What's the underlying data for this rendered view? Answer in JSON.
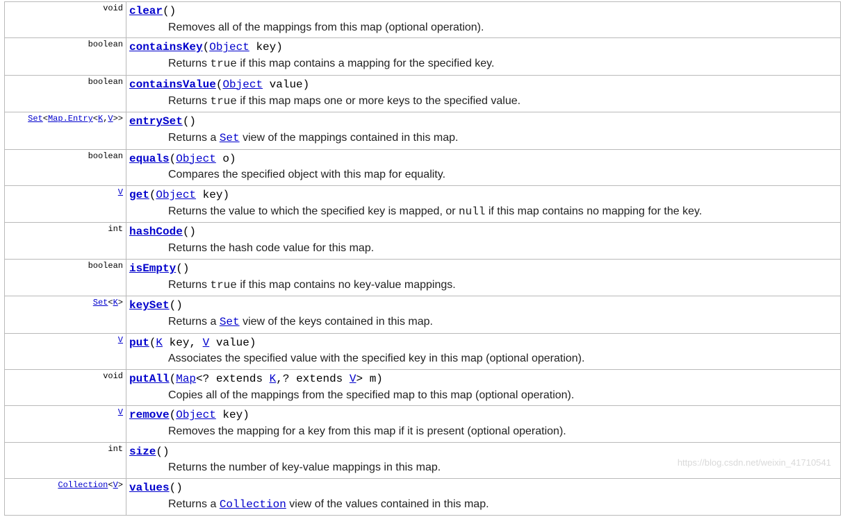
{
  "watermark": "https://blog.csdn.net/weixin_41710541",
  "methods": [
    {
      "ret_pre": "void",
      "sig_html": "<span class='mname'>clear</span>()",
      "desc_html": "Removes all of the mappings from this map (optional operation)."
    },
    {
      "ret_pre": "boolean",
      "sig_html": "<span class='mname'>containsKey</span>(<span class='plink'>Object</span> key)",
      "desc_html": "Returns <span class='code'>true</span> if this map contains a mapping for the specified key."
    },
    {
      "ret_pre": "boolean",
      "sig_html": "<span class='mname'>containsValue</span>(<span class='plink'>Object</span> value)",
      "desc_html": "Returns <span class='code'>true</span> if this map maps one or more keys to the specified value."
    },
    {
      "ret_html": "<span class='tlink'>Set</span>&lt;<span class='tlink'>Map.Entry</span>&lt;<span class='tlink'>K</span>,<span class='tlink'>V</span>&gt;&gt;",
      "sig_html": "<span class='mname'>entrySet</span>()",
      "desc_html": "Returns a <span class='dlink'>Set</span> view of the mappings contained in this map."
    },
    {
      "ret_pre": "boolean",
      "sig_html": "<span class='mname'>equals</span>(<span class='plink'>Object</span> o)",
      "desc_html": "Compares the specified object with this map for equality."
    },
    {
      "ret_html": "<span class='tlink'>V</span>",
      "sig_html": "<span class='mname'>get</span>(<span class='plink'>Object</span> key)",
      "desc_html": "Returns the value to which the specified key is mapped, or <span class='code'>null</span> if this map contains no mapping for the key."
    },
    {
      "ret_pre": "int",
      "sig_html": "<span class='mname'>hashCode</span>()",
      "desc_html": "Returns the hash code value for this map."
    },
    {
      "ret_pre": "boolean",
      "sig_html": "<span class='mname'>isEmpty</span>()",
      "desc_html": "Returns <span class='code'>true</span> if this map contains no key-value mappings."
    },
    {
      "ret_html": "<span class='tlink'>Set</span>&lt;<span class='tlink'>K</span>&gt;",
      "sig_html": "<span class='mname'>keySet</span>()",
      "desc_html": "Returns a <span class='dlink'>Set</span> view of the keys contained in this map."
    },
    {
      "ret_html": "<span class='tlink'>V</span>",
      "sig_html": "<span class='mname'>put</span>(<span class='plink'>K</span> key, <span class='plink'>V</span> value)",
      "desc_html": "Associates the specified value with the specified key in this map (optional operation)."
    },
    {
      "ret_pre": "void",
      "sig_html": "<span class='mname'>putAll</span>(<span class='plink'>Map</span>&lt;? extends <span class='plink'>K</span>,? extends <span class='plink'>V</span>&gt; m)",
      "desc_html": "Copies all of the mappings from the specified map to this map (optional operation)."
    },
    {
      "ret_html": "<span class='tlink'>V</span>",
      "sig_html": "<span class='mname'>remove</span>(<span class='plink'>Object</span> key)",
      "desc_html": "Removes the mapping for a key from this map if it is present (optional operation)."
    },
    {
      "ret_pre": "int",
      "sig_html": "<span class='mname'>size</span>()",
      "desc_html": "Returns the number of key-value mappings in this map."
    },
    {
      "ret_html": "<span class='tlink'>Collection</span>&lt;<span class='tlink'>V</span>&gt;",
      "sig_html": "<span class='mname'>values</span>()",
      "desc_html": "Returns a <span class='dlink'>Collection</span> view of the values contained in this map."
    }
  ]
}
